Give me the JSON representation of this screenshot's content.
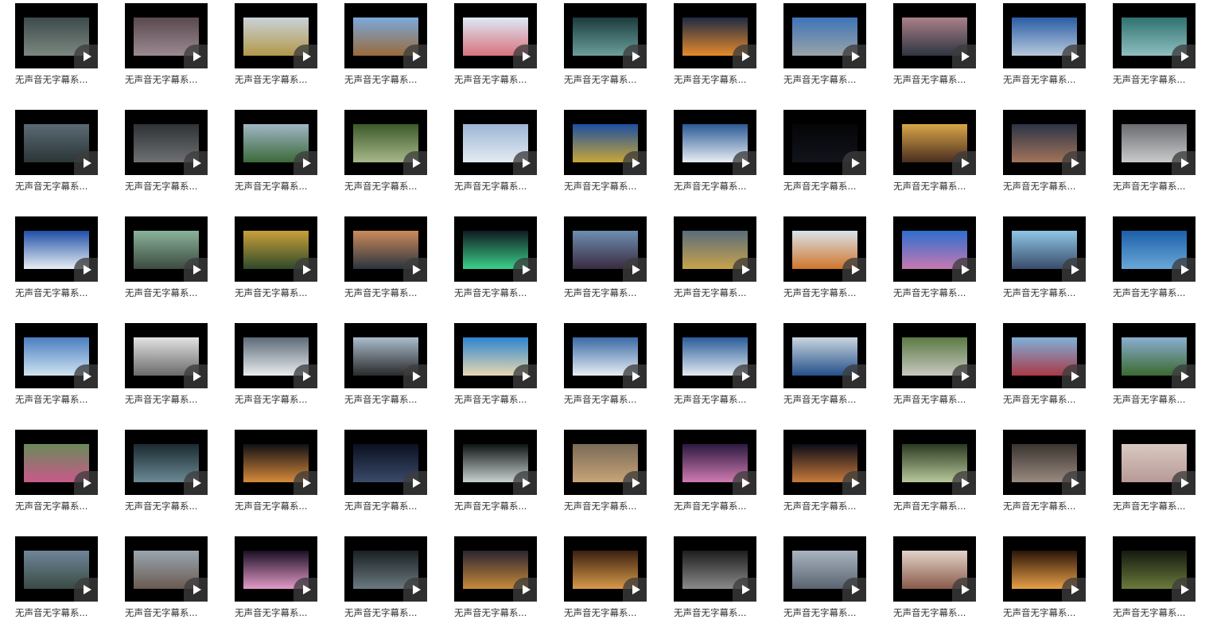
{
  "icons": {
    "play": "play-icon"
  },
  "colors": {
    "page_background": "#ffffff",
    "thumbnail_background": "#000000",
    "caption_text": "#333333"
  },
  "items": [
    {
      "caption": "无声音无字幕系...",
      "tint": [
        "#3c4a4c",
        "#7b8880"
      ]
    },
    {
      "caption": "无声音无字幕系...",
      "tint": [
        "#59484e",
        "#9c8a92"
      ]
    },
    {
      "caption": "无声音无字幕系...",
      "tint": [
        "#c9d3d9",
        "#b3984a"
      ]
    },
    {
      "caption": "无声音无字幕系...",
      "tint": [
        "#7aa9dc",
        "#9a6a3a"
      ]
    },
    {
      "caption": "无声音无字幕系...",
      "tint": [
        "#dce9f5",
        "#d8727c"
      ]
    },
    {
      "caption": "无声音无字幕系...",
      "tint": [
        "#1b3b3c",
        "#6a9f9c"
      ]
    },
    {
      "caption": "无声音无字幕系...",
      "tint": [
        "#1f2a44",
        "#e58a2c"
      ]
    },
    {
      "caption": "无声音无字幕系...",
      "tint": [
        "#3d73b8",
        "#9aa3a8"
      ]
    },
    {
      "caption": "无声音无字幕系...",
      "tint": [
        "#a98088",
        "#2e3540"
      ]
    },
    {
      "caption": "无声音无字幕系...",
      "tint": [
        "#2a5da5",
        "#b7c9db"
      ]
    },
    {
      "caption": "无声音无字幕系...",
      "tint": [
        "#2e7270",
        "#8fbfc0"
      ]
    },
    {
      "caption": "无声音无字幕系...",
      "tint": [
        "#5b6a74",
        "#2b3536"
      ]
    },
    {
      "caption": "无声音无字幕系...",
      "tint": [
        "#2e3236",
        "#6e7072"
      ]
    },
    {
      "caption": "无声音无字幕系...",
      "tint": [
        "#9fb6c4",
        "#3c6a3a"
      ]
    },
    {
      "caption": "无声音无字幕系...",
      "tint": [
        "#3d5a2a",
        "#a7b88a"
      ]
    },
    {
      "caption": "无声音无字幕系...",
      "tint": [
        "#9db6d4",
        "#e3ebf2"
      ]
    },
    {
      "caption": "无声音无字幕系...",
      "tint": [
        "#1d4fa0",
        "#c8a638"
      ]
    },
    {
      "caption": "无声音无字幕系...",
      "tint": [
        "#2a5a96",
        "#e8edf2"
      ]
    },
    {
      "caption": "无声音无字幕系...",
      "tint": [
        "#050507",
        "#12141c"
      ]
    },
    {
      "caption": "无声音无字幕系...",
      "tint": [
        "#d9a548",
        "#4a2e20"
      ]
    },
    {
      "caption": "无声音无字幕系...",
      "tint": [
        "#2c3446",
        "#a2745a"
      ]
    },
    {
      "caption": "无声音无字幕系...",
      "tint": [
        "#6a6c70",
        "#c8cacc"
      ]
    },
    {
      "caption": "无声音无字幕系...",
      "tint": [
        "#1f4fa6",
        "#e8eef4"
      ]
    },
    {
      "caption": "无声音无字幕系...",
      "tint": [
        "#8ab29a",
        "#3c4a40"
      ]
    },
    {
      "caption": "无声音无字幕系...",
      "tint": [
        "#c9a03a",
        "#2f4a2a"
      ]
    },
    {
      "caption": "无声音无字幕系...",
      "tint": [
        "#cc8a5a",
        "#2a3440"
      ]
    },
    {
      "caption": "无声音无字幕系...",
      "tint": [
        "#101a20",
        "#3ad08a"
      ]
    },
    {
      "caption": "无声音无字幕系...",
      "tint": [
        "#6d8eb0",
        "#3a2b40"
      ]
    },
    {
      "caption": "无声音无字幕系...",
      "tint": [
        "#5a6c7c",
        "#c8a34a"
      ]
    },
    {
      "caption": "无声音无字幕系...",
      "tint": [
        "#d9e2ea",
        "#d0762a"
      ]
    },
    {
      "caption": "无声音无字幕系...",
      "tint": [
        "#2d6fd0",
        "#c878b0"
      ]
    },
    {
      "caption": "无声音无字幕系...",
      "tint": [
        "#8fc5e6",
        "#3a4c6a"
      ]
    },
    {
      "caption": "无声音无字幕系...",
      "tint": [
        "#1c5fa8",
        "#6aa8d8"
      ]
    },
    {
      "caption": "无声音无字幕系...",
      "tint": [
        "#4a7fc0",
        "#cfe3f0"
      ]
    },
    {
      "caption": "无声音无字幕系...",
      "tint": [
        "#e2e2e2",
        "#6a6a6a"
      ]
    },
    {
      "caption": "无声音无字幕系...",
      "tint": [
        "#5d6b78",
        "#e8ecef"
      ]
    },
    {
      "caption": "无声音无字幕系...",
      "tint": [
        "#a9bccc",
        "#2a2a2a"
      ]
    },
    {
      "caption": "无声音无字幕系...",
      "tint": [
        "#2c84cf",
        "#e8d8b0"
      ]
    },
    {
      "caption": "无声音无字幕系...",
      "tint": [
        "#3a6aa5",
        "#e8eef3"
      ]
    },
    {
      "caption": "无声音无字幕系...",
      "tint": [
        "#2a5d9a",
        "#e3eaf0"
      ]
    },
    {
      "caption": "无声音无字幕系...",
      "tint": [
        "#c9d5df",
        "#24508a"
      ]
    },
    {
      "caption": "无声音无字幕系...",
      "tint": [
        "#5b7a44",
        "#c8c8c0"
      ]
    },
    {
      "caption": "无声音无字幕系...",
      "tint": [
        "#7fb0d8",
        "#a83a48"
      ]
    },
    {
      "caption": "无声音无字幕系...",
      "tint": [
        "#8aaed0",
        "#3c6a30"
      ]
    },
    {
      "caption": "无声音无字幕系...",
      "tint": [
        "#6a8a5a",
        "#c85a8a"
      ]
    },
    {
      "caption": "无声音无字幕系...",
      "tint": [
        "#1c2a30",
        "#6a8a96"
      ]
    },
    {
      "caption": "无声音无字幕系...",
      "tint": [
        "#101014",
        "#d68a3a"
      ]
    },
    {
      "caption": "无声音无字幕系...",
      "tint": [
        "#0a1020",
        "#3a4a6a"
      ]
    },
    {
      "caption": "无声音无字幕系...",
      "tint": [
        "#0e1414",
        "#c9d0d0"
      ]
    },
    {
      "caption": "无声音无字幕系...",
      "tint": [
        "#7a6a58",
        "#c8a478"
      ]
    },
    {
      "caption": "无声音无字幕系...",
      "tint": [
        "#2a1a40",
        "#d07ab0"
      ]
    },
    {
      "caption": "无声音无字幕系...",
      "tint": [
        "#0a0c18",
        "#c87a3a"
      ]
    },
    {
      "caption": "无声音无字幕系...",
      "tint": [
        "#2a3a22",
        "#b8c89a"
      ]
    },
    {
      "caption": "无声音无字幕系...",
      "tint": [
        "#3a3430",
        "#9a8a80"
      ]
    },
    {
      "caption": "无声音无字幕系...",
      "tint": [
        "#d8c8c0",
        "#b89a98"
      ]
    },
    {
      "caption": "无声音无字幕系...",
      "tint": [
        "#6f8698",
        "#3a4a44"
      ]
    },
    {
      "caption": "无声音无字幕系...",
      "tint": [
        "#98a6b0",
        "#6a5a50"
      ]
    },
    {
      "caption": "无声音无字幕系...",
      "tint": [
        "#1a1024",
        "#e29ac8"
      ]
    },
    {
      "caption": "无声音无字幕系...",
      "tint": [
        "#1a2024",
        "#6a7a80"
      ]
    },
    {
      "caption": "无声音无字幕系...",
      "tint": [
        "#2a2430",
        "#c88a3a"
      ]
    },
    {
      "caption": "无声音无字幕系...",
      "tint": [
        "#3a2010",
        "#d89a4a"
      ]
    },
    {
      "caption": "无声音无字幕系...",
      "tint": [
        "#1e1e1e",
        "#8a8a8a"
      ]
    },
    {
      "caption": "无声音无字幕系...",
      "tint": [
        "#aab4c0",
        "#5a6470"
      ]
    },
    {
      "caption": "无声音无字幕系...",
      "tint": [
        "#e2d2c8",
        "#8a5a4a"
      ]
    },
    {
      "caption": "无声音无字幕系...",
      "tint": [
        "#2a1408",
        "#e8a048"
      ]
    },
    {
      "caption": "无声音无字幕系...",
      "tint": [
        "#141a10",
        "#6a7a3a"
      ]
    }
  ]
}
